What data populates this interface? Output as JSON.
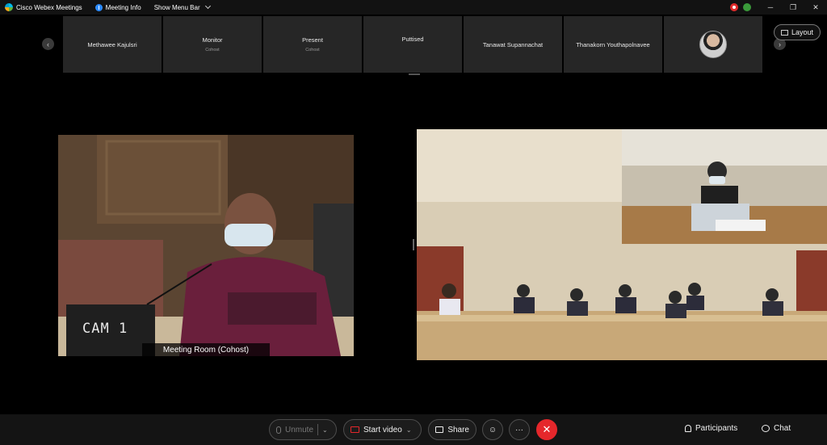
{
  "titlebar": {
    "app_name": "Cisco Webex Meetings",
    "meeting_info": "Meeting Info",
    "menu_toggle": "Show Menu Bar",
    "minimize": "─",
    "restore": "❐",
    "close": "✕"
  },
  "participants": [
    {
      "name": "Methawee Kajulsri",
      "role": ""
    },
    {
      "name": "Monitor",
      "role": "Cohost"
    },
    {
      "name": "Present",
      "role": "Cohost"
    },
    {
      "name": "Puttised",
      "role": ""
    },
    {
      "name": "Tanawat Supannachat",
      "role": ""
    },
    {
      "name": "Thanakorn Youthapolnavee",
      "role": ""
    }
  ],
  "strip_nav": {
    "prev": "‹",
    "next": "›"
  },
  "layout_button": "Layout",
  "main_video": {
    "camera_label": "CAM 1",
    "name_label": "Meeting Room (Cohost)"
  },
  "toolbar": {
    "unmute": "Unmute",
    "start_video": "Start video",
    "share": "Share",
    "more": "···",
    "end": "✕",
    "participants": "Participants",
    "chat": "Chat",
    "caret": "⌄"
  },
  "colors": {
    "end_call": "#e5272b",
    "background": "#000000",
    "tile": "#262626"
  }
}
